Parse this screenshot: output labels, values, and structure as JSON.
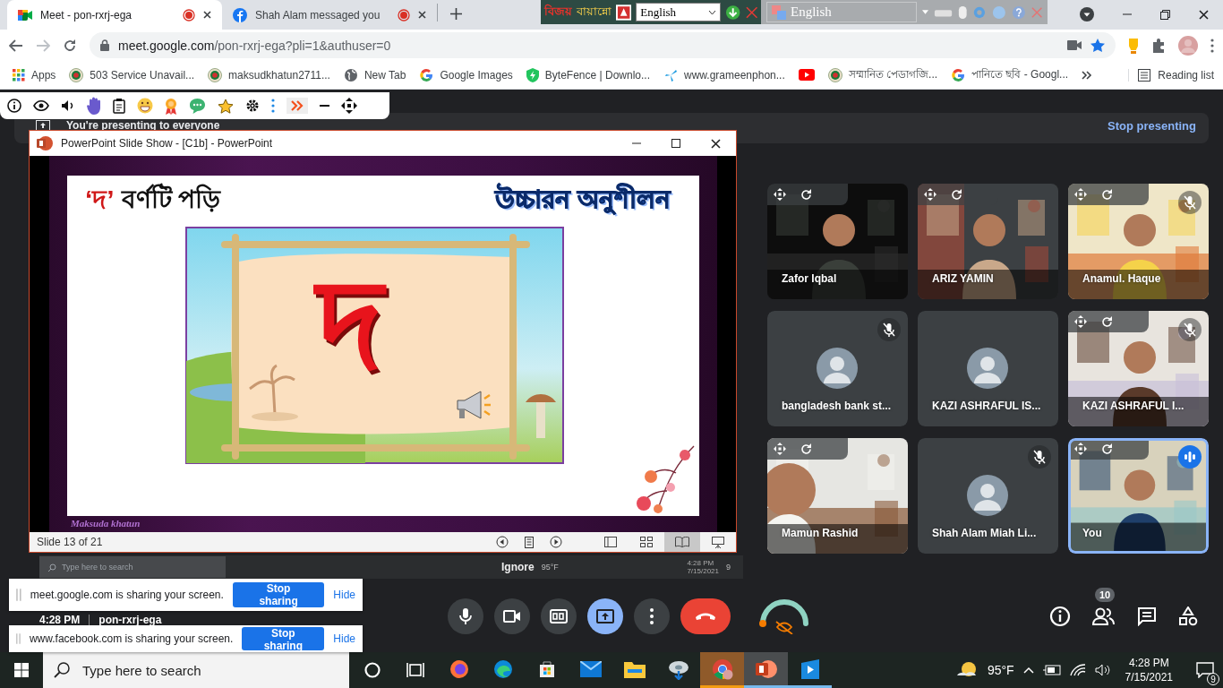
{
  "browser": {
    "tabs": [
      {
        "title": "Meet - pon-rxrj-ega",
        "recording": true,
        "selected": true
      },
      {
        "title": "Shah Alam messaged you",
        "recording": true,
        "selected": false
      }
    ],
    "ime": {
      "brand": "বিজয়",
      "name": "বায়ান্নো",
      "layout": "English",
      "language": "English"
    },
    "address": {
      "host": "meet.google.com",
      "path": "/pon-rxrj-ega?pli=1&authuser=0",
      "starred": true
    },
    "bookmarks": [
      "Apps",
      "503 Service Unavail...",
      "maksudkhatun2711...",
      "New Tab",
      "Google Images",
      "ByteFence | Downlo...",
      "www.grameenphon...",
      "সম্মানিত পেডাগজি...",
      "পানিতে ছবি - Googl..."
    ],
    "reading_list": "Reading list"
  },
  "meet": {
    "banner": "You're presenting to everyone",
    "stop_presenting": "Stop presenting",
    "slideshow": {
      "title": "PowerPoint Slide Show - [C1b] - PowerPoint",
      "quote_letter": "‘দ’",
      "heading": "বর্ণটি পড়ি",
      "slide_title": "উচ্চারন অনুশীলন",
      "letter": "দ",
      "signature": "Maksuda khatun",
      "status": "Slide 13 of 21",
      "views": [
        {
          "kind": "normal",
          "selected": false
        },
        {
          "kind": "sorter",
          "selected": false
        },
        {
          "kind": "reading",
          "selected": true
        },
        {
          "kind": "slideshow",
          "selected": false
        }
      ]
    },
    "tiles": [
      {
        "name": "Zafor Iqbal",
        "kind": "video",
        "muted": false,
        "speaking": false
      },
      {
        "name": "ARIZ YAMIN",
        "kind": "video",
        "muted": false,
        "speaking": false
      },
      {
        "name": "Anamul. Haque",
        "kind": "video",
        "muted": true,
        "speaking": false
      },
      {
        "name": "bangladesh bank st...",
        "kind": "avatar",
        "muted": true,
        "speaking": false
      },
      {
        "name": "KAZI ASHRAFUL IS...",
        "kind": "avatar",
        "muted": false,
        "speaking": false
      },
      {
        "name": "KAZI ASHRAFUL I...",
        "kind": "video",
        "muted": true,
        "speaking": false
      },
      {
        "name": "Mamun Rashid",
        "kind": "video",
        "muted": false,
        "speaking": false
      },
      {
        "name": "Shah Alam Miah Li...",
        "kind": "avatar",
        "muted": true,
        "speaking": false
      },
      {
        "name": "You",
        "kind": "video",
        "muted": false,
        "speaking": true
      }
    ],
    "shared_screen": {
      "search_placeholder": "Type here to search",
      "prompt": "Ignore",
      "temperature": "95°F",
      "time": "4:28 PM",
      "date": "7/15/2021",
      "notifications": "9"
    },
    "sharing_bars": [
      {
        "text": "meet.google.com is sharing your screen.",
        "stop": "Stop sharing",
        "hide": "Hide"
      },
      {
        "text": "www.facebook.com is sharing your screen.",
        "stop": "Stop sharing",
        "hide": "Hide"
      }
    ],
    "meeting": {
      "time": "4:28 PM",
      "code": "pon-rxrj-ega"
    },
    "controls": [
      {
        "kind": "mic",
        "active": false
      },
      {
        "kind": "camera",
        "active": false
      },
      {
        "kind": "captions",
        "active": false
      },
      {
        "kind": "present",
        "active": true
      },
      {
        "kind": "more",
        "active": false
      },
      {
        "kind": "hangup",
        "active": false
      }
    ],
    "people_count": "10"
  },
  "taskbar": {
    "search_placeholder": "Type here to search",
    "apps": [
      {
        "kind": "firefox",
        "running": false,
        "focused": false,
        "attention": false
      },
      {
        "kind": "edge",
        "running": false,
        "focused": false,
        "attention": false
      },
      {
        "kind": "store",
        "running": false,
        "focused": false,
        "attention": false
      },
      {
        "kind": "mail",
        "running": false,
        "focused": false,
        "attention": false
      },
      {
        "kind": "explorer",
        "running": false,
        "focused": false,
        "attention": false
      },
      {
        "kind": "disc",
        "running": false,
        "focused": false,
        "attention": false
      },
      {
        "kind": "chrome",
        "running": true,
        "focused": false,
        "attention": true
      },
      {
        "kind": "powerpoint",
        "running": true,
        "focused": true,
        "attention": false
      },
      {
        "kind": "player",
        "running": true,
        "focused": false,
        "attention": false
      }
    ],
    "temperature": "95°F",
    "time": "4:28 PM",
    "date": "7/15/2021",
    "notifications": "9"
  }
}
